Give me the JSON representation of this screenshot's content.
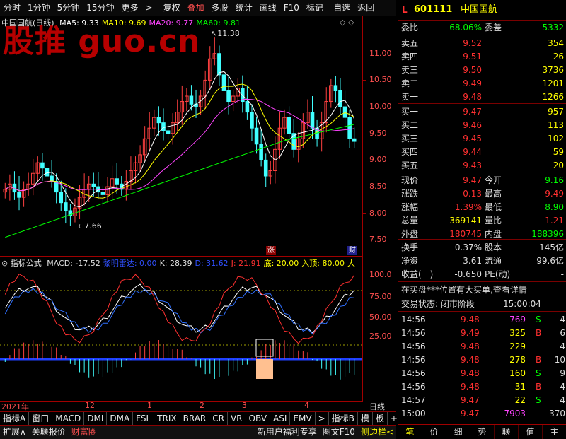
{
  "toolbar": {
    "items": [
      "分时",
      "1分钟",
      "5分钟",
      "15分钟",
      "更多",
      ">",
      "复权",
      "叠加",
      "多股",
      "统计",
      "画线",
      "F10",
      "标记",
      "-自选",
      "返回"
    ]
  },
  "chart": {
    "stock_title": "中国国航(日线)",
    "ma": [
      {
        "label": "MA5: 9.33",
        "color": "#ffffff"
      },
      {
        "label": "MA10: 9.69",
        "color": "#ffff00"
      },
      {
        "label": "MA20: 9.77",
        "color": "#ff44ff"
      },
      {
        "label": "MA60: 9.81",
        "color": "#00ff00"
      }
    ],
    "watermark": "股推 guo.cn",
    "high_label": "11.38",
    "low_label": "7.66",
    "price_ticks": [
      "11.00",
      "10.50",
      "10.00",
      "9.50",
      "9.00",
      "8.50",
      "8.00",
      "7.50"
    ],
    "event_marks": {
      "up": "涨",
      "fin": "财"
    }
  },
  "indicator": {
    "title": "指标公式",
    "values": [
      {
        "label": "MACD: -17.52",
        "color": "#e0e0e0"
      },
      {
        "label": "黎明雷达: 0.00",
        "color": "#3050ff"
      },
      {
        "label": "K: 28.39",
        "color": "#e0e0e0"
      },
      {
        "label": "D: 31.62",
        "color": "#3050ff"
      },
      {
        "label": "J: 21.91",
        "color": "#ff3030"
      },
      {
        "label": "底: 20.00",
        "color": "#ffff00"
      },
      {
        "label": "入顶: 80.00",
        "color": "#ffff00"
      },
      {
        "label": "大",
        "color": "#ffff00"
      }
    ],
    "ticks": [
      "100.0",
      "75.00",
      "50.00",
      "25.00"
    ]
  },
  "xaxis": {
    "labels": [
      "2021年",
      "12",
      "1",
      "2",
      "3",
      "4"
    ],
    "period_label": "日线"
  },
  "tabs_a": [
    "指标A",
    "窗口",
    "MACD",
    "DMI",
    "DMA",
    "FSL",
    "TRIX",
    "BRAR",
    "CR",
    "VR",
    "OBV",
    "ASI",
    "EMV",
    ">",
    "指标B",
    "模",
    "板",
    "+",
    "-"
  ],
  "tabs_b": [
    "扩展∧",
    "关联报价",
    "财富圈"
  ],
  "tabs_b_right": [
    "新用户福利专享",
    "图文F10",
    "侧边栏<"
  ],
  "quote": {
    "badge": "L",
    "code": "601111",
    "name": "中国国航",
    "weibi_label": "委比",
    "weibi_value": "-68.06%",
    "weicha_label": "委差",
    "weicha_value": "-5332",
    "asks": [
      {
        "label": "卖五",
        "price": "9.52",
        "vol": "354"
      },
      {
        "label": "卖四",
        "price": "9.51",
        "vol": "26"
      },
      {
        "label": "卖三",
        "price": "9.50",
        "vol": "3736"
      },
      {
        "label": "卖二",
        "price": "9.49",
        "vol": "1201"
      },
      {
        "label": "卖一",
        "price": "9.48",
        "vol": "1266"
      }
    ],
    "bids": [
      {
        "label": "买一",
        "price": "9.47",
        "vol": "957"
      },
      {
        "label": "买二",
        "price": "9.46",
        "vol": "113"
      },
      {
        "label": "买三",
        "price": "9.45",
        "vol": "102"
      },
      {
        "label": "买四",
        "price": "9.44",
        "vol": "59"
      },
      {
        "label": "买五",
        "price": "9.43",
        "vol": "20"
      }
    ],
    "stats": [
      {
        "l1": "现价",
        "v1": "9.47",
        "c1": "#ff3030",
        "l2": "今开",
        "v2": "9.16",
        "c2": "#00ff00"
      },
      {
        "l1": "涨跌",
        "v1": "0.13",
        "c1": "#ff3030",
        "l2": "最高",
        "v2": "9.49",
        "c2": "#ff3030"
      },
      {
        "l1": "涨幅",
        "v1": "1.39%",
        "c1": "#ff3030",
        "l2": "最低",
        "v2": "8.90",
        "c2": "#00ff00"
      },
      {
        "l1": "总量",
        "v1": "369141",
        "c1": "#ffff00",
        "l2": "量比",
        "v2": "1.21",
        "c2": "#ff3030"
      },
      {
        "l1": "外盘",
        "v1": "180745",
        "c1": "#ff3030",
        "l2": "内盘",
        "v2": "188396",
        "c2": "#00ff00"
      }
    ],
    "stats2": [
      {
        "l1": "换手",
        "v1": "0.37%",
        "l2": "股本",
        "v2": "145亿"
      },
      {
        "l1": "净资",
        "v1": "3.61",
        "l2": "流通",
        "v2": "99.6亿"
      },
      {
        "l1": "收益(一)",
        "v1": "-0.650",
        "l2": "PE(动)",
        "v2": "-"
      }
    ],
    "notice": "在买盘***位置有大买单,查看详情",
    "status_label": "交易状态: 闭市阶段",
    "status_time": "15:00:04",
    "ticks": [
      {
        "t": "14:56",
        "p": "9.48",
        "v": "769",
        "vc": "#ff44ff",
        "s": "S",
        "sc": "#00ff00",
        "n": "4"
      },
      {
        "t": "14:56",
        "p": "9.49",
        "v": "325",
        "vc": "#ffff00",
        "s": "B",
        "sc": "#ff3030",
        "n": "6"
      },
      {
        "t": "14:56",
        "p": "9.48",
        "v": "229",
        "vc": "#ffff00",
        "s": "",
        "sc": "#ffffff",
        "n": "4"
      },
      {
        "t": "14:56",
        "p": "9.48",
        "v": "278",
        "vc": "#ffff00",
        "s": "B",
        "sc": "#ff3030",
        "n": "10"
      },
      {
        "t": "14:56",
        "p": "9.48",
        "v": "160",
        "vc": "#ffff00",
        "s": "S",
        "sc": "#00ff00",
        "n": "9"
      },
      {
        "t": "14:56",
        "p": "9.48",
        "v": "31",
        "vc": "#ffff00",
        "s": "B",
        "sc": "#ff3030",
        "n": "4"
      },
      {
        "t": "14:57",
        "p": "9.47",
        "v": "22",
        "vc": "#ffff00",
        "s": "S",
        "sc": "#00ff00",
        "n": "4"
      },
      {
        "t": "15:00",
        "p": "9.47",
        "v": "7903",
        "vc": "#ff44ff",
        "s": "",
        "sc": "#ffffff",
        "n": "370"
      }
    ],
    "bottom_tabs": [
      "笔",
      "价",
      "细",
      "势",
      "联",
      "值",
      "主"
    ]
  }
}
